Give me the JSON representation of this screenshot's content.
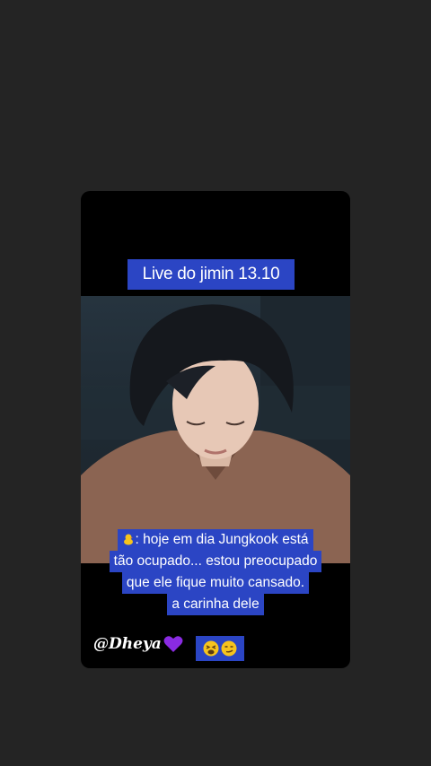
{
  "story": {
    "title": "Live do jimin 13.10",
    "caption_lines": [
      ": hoje em dia Jungkook está",
      "tão ocupado... estou preocupado",
      "que ele fique muito cansado.",
      "a carinha dele"
    ],
    "caption_lead_icon": "chick-icon",
    "credit": "@Dheya",
    "credit_icon": "purple-heart-icon",
    "reaction_icons": [
      "tired-face-icon",
      "smirk-face-icon"
    ]
  },
  "colors": {
    "background": "#242424",
    "badge": "#2b45c4",
    "heart": "#8a2be2"
  }
}
